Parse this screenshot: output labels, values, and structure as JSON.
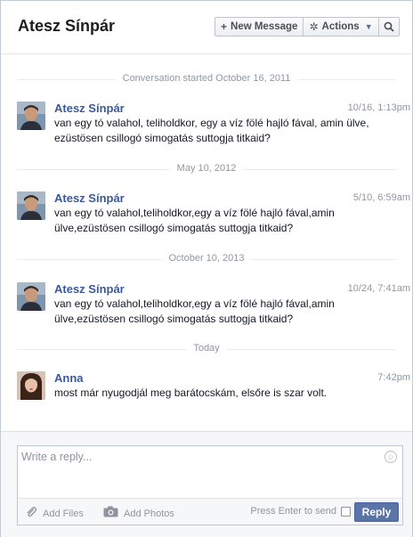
{
  "header": {
    "title": "Atesz Sínpár",
    "new_message_label": "New Message",
    "actions_label": "Actions",
    "icons": {
      "new_message": "plus-icon",
      "actions": "gear-icon",
      "search": "search-icon"
    }
  },
  "thread": {
    "dividers": [
      "Conversation started October 16, 2011",
      "May 10, 2012",
      "October 10, 2013",
      "Today"
    ],
    "messages": [
      {
        "sender": "Atesz Sínpár",
        "time": "10/16, 1:13pm",
        "text": "van egy tó valahol, teliholdkor, egy a víz fölé hajló fával, amin ülve, ezüstösen csillogó simogatás suttogja titkaid?"
      },
      {
        "sender": "Atesz Sínpár",
        "time": "5/10, 6:59am",
        "text": "van egy tó valahol,teliholdkor,egy a víz fölé hajló fával,amin ülve,ezüstösen csillogó simogatás suttogja titkaid?"
      },
      {
        "sender": "Atesz Sínpár",
        "time": "10/24, 7:41am",
        "text": "van egy tó valahol,teliholdkor,egy a víz fölé hajló fával,amin ülve,ezüstösen csillogó simogatás suttogja titkaid?"
      },
      {
        "sender": "Anna",
        "time": "7:42pm",
        "text": "most már nyugodjál meg barátocskám, elsőre is szar volt."
      }
    ]
  },
  "composer": {
    "placeholder": "Write a reply...",
    "add_files_label": "Add Files",
    "add_photos_label": "Add Photos",
    "press_enter_label": "Press Enter to send",
    "press_enter_checked": false,
    "reply_label": "Reply"
  },
  "colors": {
    "sender_link": "#3b5998",
    "reply_button": "#5b74a8",
    "meta_text": "#9197a3"
  }
}
